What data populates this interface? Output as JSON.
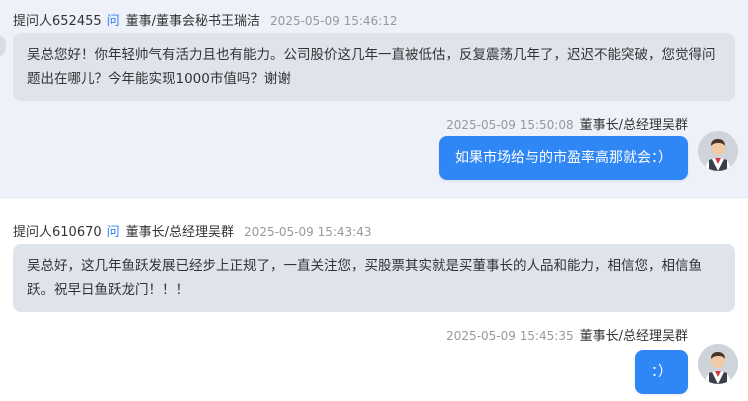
{
  "threads": [
    {
      "question": {
        "asker": "提问人652455",
        "tag": "问",
        "to": "董事/董事会秘书王瑞洁",
        "time": "2025-05-09 15:46:12",
        "text": "吴总您好！你年轻帅气有活力且也有能力。公司股价这几年一直被低估，反复震荡几年了，迟迟不能突破，您觉得问题出在哪儿？今年能实现1000市值吗？谢谢"
      },
      "answer": {
        "time": "2025-05-09 15:50:08",
        "who": "董事长/总经理吴群",
        "text": "如果市场给与的市盈率高那就会：）"
      }
    },
    {
      "question": {
        "asker": "提问人610670",
        "tag": "问",
        "to": "董事长/总经理吴群",
        "time": "2025-05-09 15:43:43",
        "text": "吴总好，这几年鱼跃发展已经步上正规了，一直关注您，买股票其实就是买董事长的人品和能力，相信您，相信鱼跃。祝早日鱼跃龙门！！！"
      },
      "answer": {
        "time": "2025-05-09 15:45:35",
        "who": "董事长/总经理吴群",
        "text": "：）"
      }
    }
  ],
  "colors": {
    "accent": "#2f87f5",
    "question_bubble": "#dfe4ec",
    "thread1_bg": "#eef1f9"
  },
  "icons": {
    "avatar": "user-avatar-icon"
  }
}
